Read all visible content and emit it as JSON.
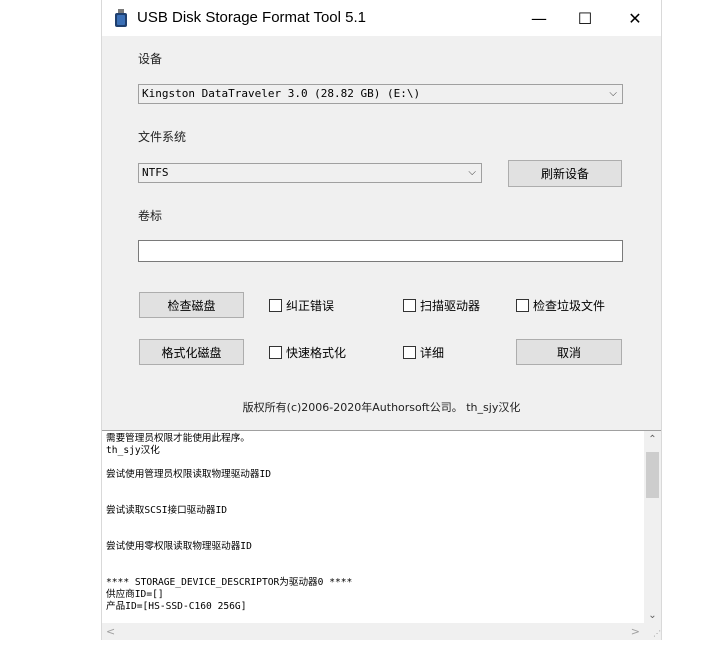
{
  "window": {
    "title": "USB Disk Storage Format Tool 5.1",
    "minimize_glyph": "—",
    "maximize_glyph": "☐",
    "close_glyph": "✕",
    "icon": "usb-drive-icon"
  },
  "device": {
    "label": "设备",
    "selected": "Kingston  DataTraveler 3.0   (28.82 GB) (E:\\)",
    "arrow": "⌵"
  },
  "filesystem": {
    "label": "文件系统",
    "selected": "NTFS",
    "arrow": "⌵",
    "refresh_button": "刷新设备"
  },
  "volume": {
    "label": "卷标",
    "value": ""
  },
  "actions": {
    "check_disk": "检查磁盘",
    "format_disk": "格式化磁盘",
    "cancel": "取消"
  },
  "options": {
    "correct_errors": "纠正错误",
    "scan_drive": "扫描驱动器",
    "check_junk": "检查垃圾文件",
    "quick_format": "快速格式化",
    "verbose": "详细"
  },
  "copyright": "版权所有(c)2006-2020年Authorsoft公司。  th_sjy汉化",
  "log": {
    "text": "需要管理员权限才能使用此程序。\nth_sjy汉化\n\n尝试使用管理员权限读取物理驱动器ID\n\n\n尝试读取SCSI接口驱动器ID\n\n\n尝试使用零权限读取物理驱动器ID\n\n\n**** STORAGE_DEVICE_DESCRIPTOR为驱动器0 ****\n供应商ID=[]\n产品ID=[HS-SSD-C160 256G]"
  },
  "scrollbars": {
    "up": "⌃",
    "down": "⌄",
    "left": "<",
    "right": ">"
  },
  "colors": {
    "window_bg": "#f0f0f0",
    "titlebar_bg": "#ffffff",
    "button_bg": "#e1e1e1"
  }
}
